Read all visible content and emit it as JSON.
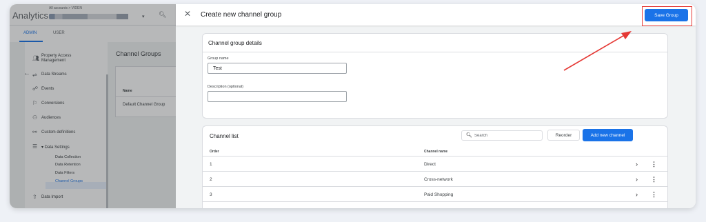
{
  "background": {
    "logo": "Analytics",
    "account_label": "All accounts > VIDEN",
    "tabs": [
      "ADMIN",
      "USER"
    ],
    "nav": [
      {
        "label": "Property Access",
        "label2": "Management",
        "icon": "people-icon"
      },
      {
        "label": "Data Streams",
        "icon": "streams-icon"
      },
      {
        "label": "Events",
        "icon": "events-icon"
      },
      {
        "label": "Conversions",
        "icon": "flag-icon"
      },
      {
        "label": "Audiences",
        "icon": "audiences-icon"
      },
      {
        "label": "Custom definitions",
        "icon": "custom-definitions-icon"
      },
      {
        "label": "▾ Data Settings",
        "icon": "database-icon"
      },
      {
        "label": "Data Import",
        "icon": "upload-icon"
      }
    ],
    "data_settings_sub": [
      "Data Collection",
      "Data Retention",
      "Data Filters",
      "Channel Groups"
    ],
    "page_title": "Channel Groups",
    "table_header": "Name",
    "table_row": "Default Channel Group"
  },
  "drawer": {
    "title": "Create new channel group",
    "save_label": "Save Group",
    "details": {
      "title": "Channel group details",
      "group_name_label": "Group name",
      "group_name_value": "Test",
      "description_label": "Description (optional)",
      "description_value": ""
    },
    "channel_list": {
      "title": "Channel list",
      "search_placeholder": "Search",
      "reorder_label": "Reorder",
      "add_label": "Add new channel",
      "columns": [
        "Order",
        "Channel name"
      ],
      "rows": [
        {
          "order": "1",
          "name": "Direct"
        },
        {
          "order": "2",
          "name": "Cross-network"
        },
        {
          "order": "3",
          "name": "Paid Shopping"
        }
      ]
    }
  },
  "colors": {
    "accent": "#1a73e8",
    "highlight": "#e53935"
  }
}
